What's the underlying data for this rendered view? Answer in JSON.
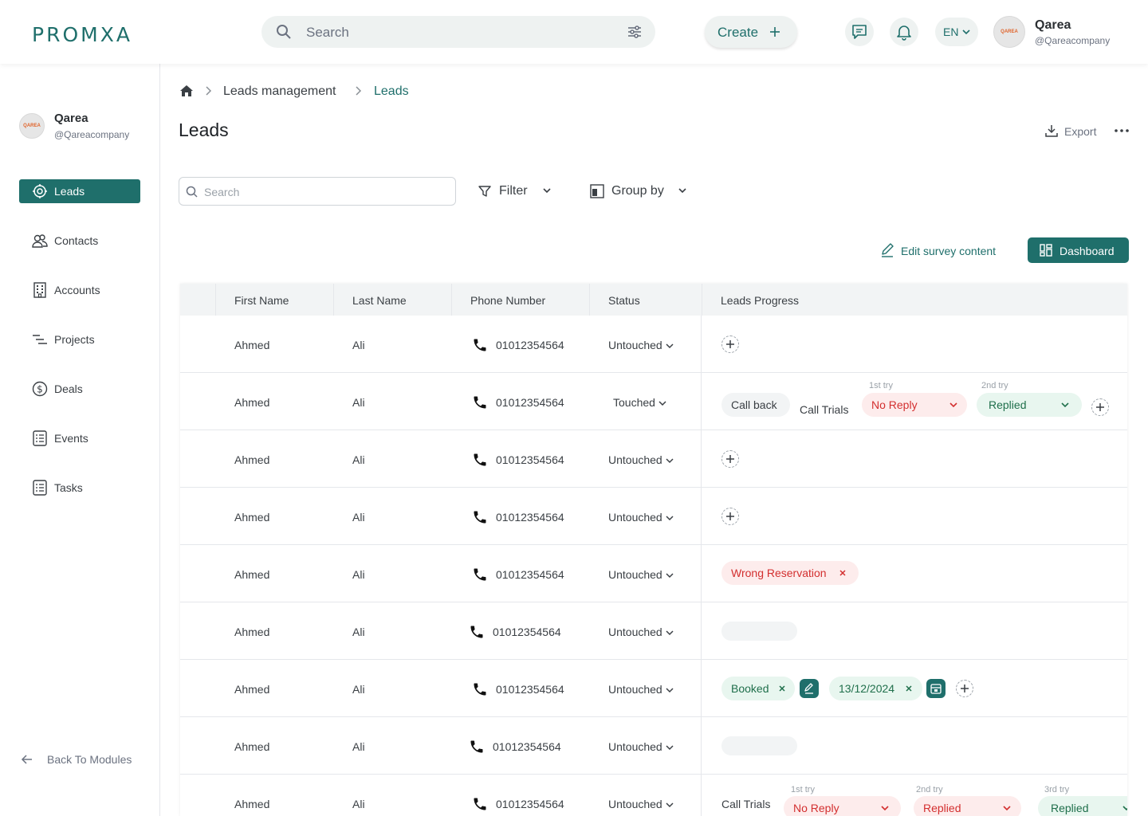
{
  "app": {
    "logo": "PROMXA",
    "search_placeholder": "Search",
    "create_label": "Create",
    "language": "EN",
    "user": {
      "name": "Qarea",
      "handle": "@Qareacompany",
      "avatar_mark": "QAREA"
    }
  },
  "sidebar": {
    "user": {
      "name": "Qarea",
      "handle": "@Qareacompany"
    },
    "items": [
      {
        "label": "Leads",
        "icon": "target-icon",
        "active": true
      },
      {
        "label": "Contacts",
        "icon": "contacts-icon"
      },
      {
        "label": "Accounts",
        "icon": "building-icon"
      },
      {
        "label": "Projects",
        "icon": "projects-icon"
      },
      {
        "label": "Deals",
        "icon": "dollar-icon"
      },
      {
        "label": "Events",
        "icon": "checklist-icon"
      },
      {
        "label": "Tasks",
        "icon": "checklist-icon"
      }
    ],
    "back_label": "Back To Modules"
  },
  "breadcrumb": {
    "items": [
      "Leads management",
      "Leads"
    ]
  },
  "page": {
    "title": "Leads",
    "export_label": "Export",
    "search_placeholder": "Search",
    "filter_label": "Filter",
    "groupby_label": "Group by",
    "edit_survey_label": "Edit survey content",
    "dashboard_label": "Dashboard"
  },
  "table": {
    "columns": [
      "First Name",
      "Last Name",
      "Phone Number",
      "Status",
      "Leads Progress"
    ],
    "rows": [
      {
        "first": "Ahmed",
        "last": "Ali",
        "phone": "01012354564",
        "status": "Untouched"
      },
      {
        "first": "Ahmed",
        "last": "Ali",
        "phone": "01012354564",
        "status": "Touched",
        "progress": {
          "call_back": "Call back",
          "call_trials": "Call Trials",
          "try1_label": "1st try",
          "try1": "No Reply",
          "try2_label": "2nd try",
          "try2": "Replied"
        }
      },
      {
        "first": "Ahmed",
        "last": "Ali",
        "phone": "01012354564",
        "status": "Untouched"
      },
      {
        "first": "Ahmed",
        "last": "Ali",
        "phone": "01012354564",
        "status": "Untouched"
      },
      {
        "first": "Ahmed",
        "last": "Ali",
        "phone": "01012354564",
        "status": "Untouched",
        "progress": {
          "tag": "Wrong Reservation"
        }
      },
      {
        "first": "Ahmed",
        "last": "Ali",
        "phone": "01012354564",
        "status": "Untouched"
      },
      {
        "first": "Ahmed",
        "last": "Ali",
        "phone": "01012354564",
        "status": "Untouched",
        "progress": {
          "tag": "Booked",
          "date": "13/12/2024"
        }
      },
      {
        "first": "Ahmed",
        "last": "Ali",
        "phone": "01012354564",
        "status": "Untouched"
      },
      {
        "first": "Ahmed",
        "last": "Ali",
        "phone": "01012354564",
        "status": "Untouched",
        "progress": {
          "call_trials": "Call Trials",
          "try1_label": "1st try",
          "try1": "No Reply",
          "try2_label": "2nd try",
          "try2": "Replied",
          "try3_label": "3rd try",
          "try3": "Replied"
        }
      }
    ]
  },
  "colors": {
    "brand": "#1f6f6b",
    "danger": "#d32f2f",
    "success": "#1f6f4b"
  }
}
